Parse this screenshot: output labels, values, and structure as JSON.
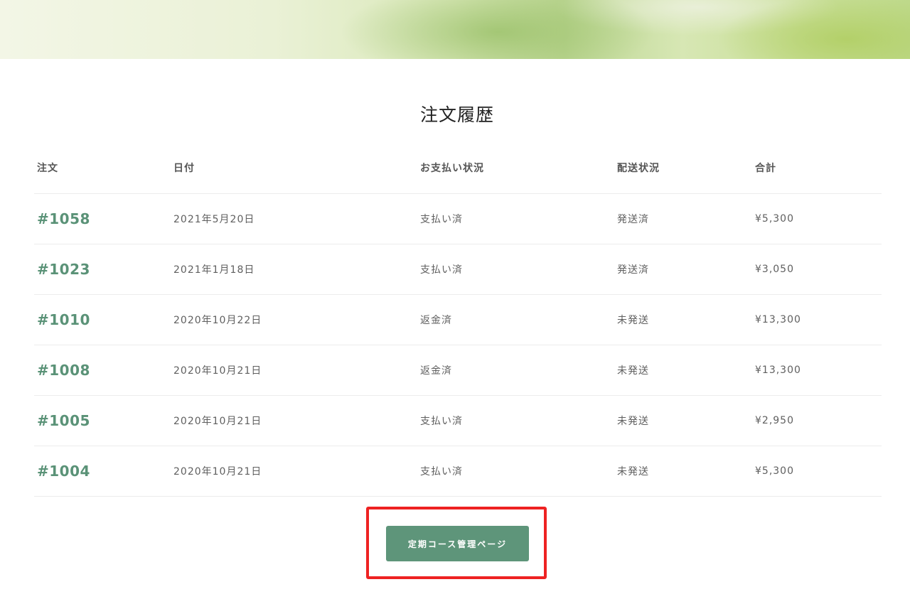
{
  "page": {
    "title": "注文履歴"
  },
  "table": {
    "headers": {
      "order": "注文",
      "date": "日付",
      "payment": "お支払い状況",
      "shipping": "配送状況",
      "total": "合計"
    },
    "rows": [
      {
        "order": "#1058",
        "date": "2021年5月20日",
        "payment": "支払い済",
        "shipping": "発送済",
        "total": "¥5,300"
      },
      {
        "order": "#1023",
        "date": "2021年1月18日",
        "payment": "支払い済",
        "shipping": "発送済",
        "total": "¥3,050"
      },
      {
        "order": "#1010",
        "date": "2020年10月22日",
        "payment": "返金済",
        "shipping": "未発送",
        "total": "¥13,300"
      },
      {
        "order": "#1008",
        "date": "2020年10月21日",
        "payment": "返金済",
        "shipping": "未発送",
        "total": "¥13,300"
      },
      {
        "order": "#1005",
        "date": "2020年10月21日",
        "payment": "支払い済",
        "shipping": "未発送",
        "total": "¥2,950"
      },
      {
        "order": "#1004",
        "date": "2020年10月21日",
        "payment": "支払い済",
        "shipping": "未発送",
        "total": "¥5,300"
      }
    ]
  },
  "actions": {
    "manage_subscription_label": "定期コース管理ページ"
  },
  "colors": {
    "accent": "#5e957a",
    "order_link": "#5a9277",
    "highlight": "#ee2222"
  }
}
